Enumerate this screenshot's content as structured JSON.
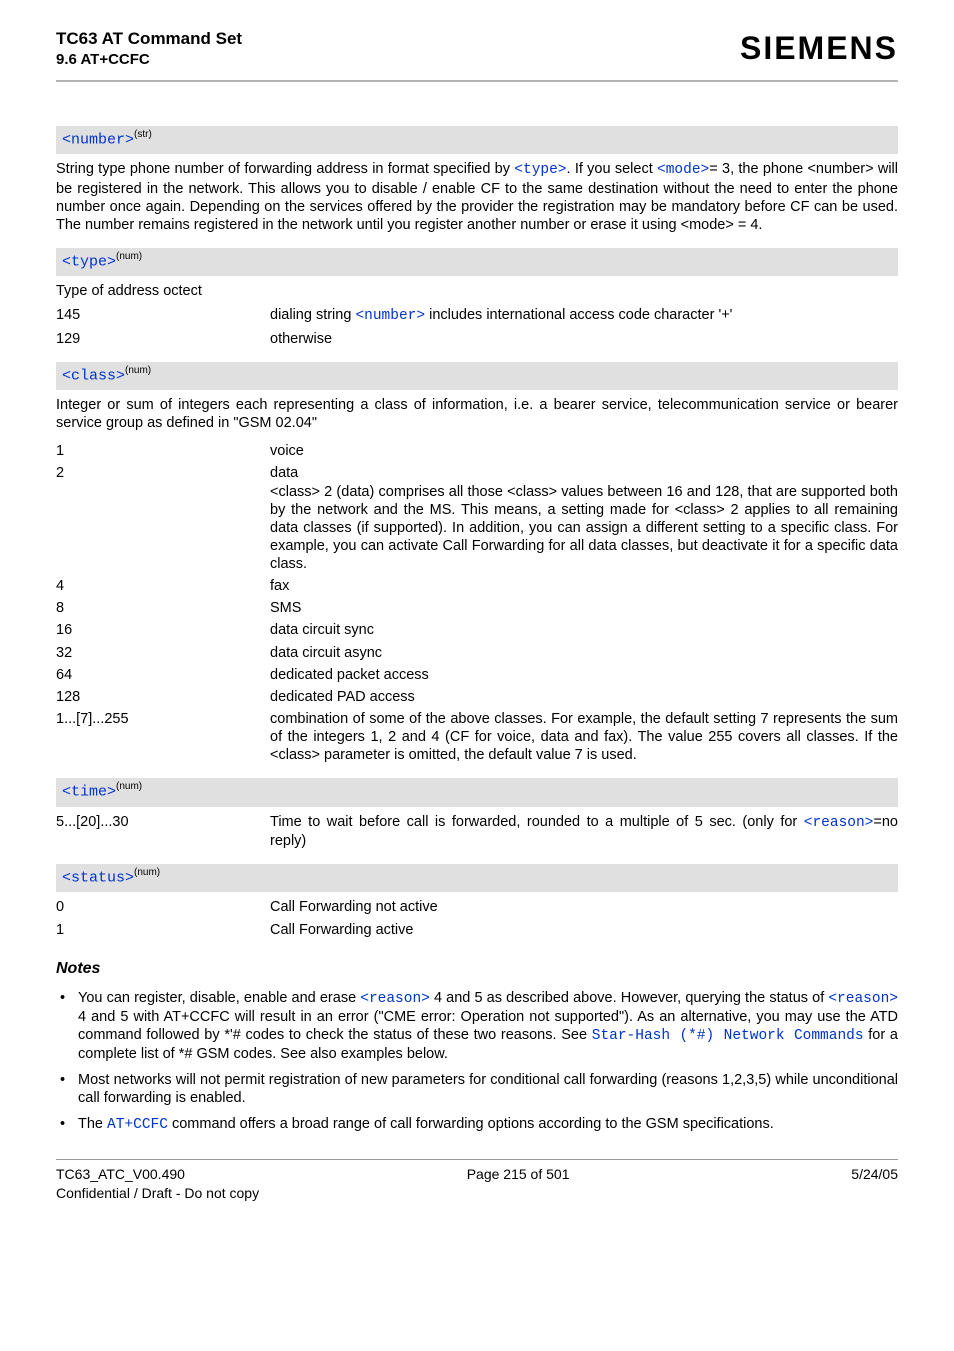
{
  "header": {
    "doc_title": "TC63 AT Command Set",
    "doc_subtitle": "9.6 AT+CCFC",
    "brand": "SIEMENS"
  },
  "params": {
    "number": {
      "name": "<number>",
      "sup": "(str)",
      "desc_pre": "String type phone number of forwarding address in format specified by ",
      "link1": "<type>",
      "desc_mid": ". If you select ",
      "link2": "<mode>",
      "desc_post": "= 3, the phone <number> will be registered in the network. This allows you to disable / enable CF to the same destination without the need to enter the phone number once again. Depending on the services offered by the provider the registration may be mandatory before CF can be used. The number remains registered in the network until you register another number or erase it using <mode> = 4."
    },
    "type": {
      "name": "<type>",
      "sup": "(num)",
      "desc": "Type of address octect",
      "rows": [
        {
          "k": "145",
          "pre": "dialing string ",
          "link": "<number>",
          "post": " includes international access code character '+'"
        },
        {
          "k": "129",
          "pre": "otherwise",
          "link": "",
          "post": ""
        }
      ]
    },
    "class": {
      "name": "<class>",
      "sup": "(num)",
      "desc": "Integer or sum of integers each representing a class of information, i.e. a bearer service, telecommunication service or bearer service group as defined in \"GSM 02.04\"",
      "rows": [
        {
          "k": "1",
          "v": "voice"
        },
        {
          "k": "2",
          "v": "data\n<class> 2 (data) comprises all those <class> values between 16 and 128, that are supported both by the network and the MS. This means, a setting made for <class> 2 applies to all remaining data classes (if supported). In addition, you can assign a different setting to a specific class. For example, you can activate Call Forwarding for all data classes, but deactivate it for a specific data class."
        },
        {
          "k": "4",
          "v": "fax"
        },
        {
          "k": "8",
          "v": "SMS"
        },
        {
          "k": "16",
          "v": "data circuit sync"
        },
        {
          "k": "32",
          "v": "data circuit async"
        },
        {
          "k": "64",
          "v": "dedicated packet access"
        },
        {
          "k": "128",
          "v": "dedicated PAD access"
        },
        {
          "k": "1...[7]...255",
          "v": "combination of some of the above classes. For example, the default setting 7 represents the sum of the integers 1, 2 and 4 (CF for voice, data and fax). The value 255 covers all classes. If the <class> parameter is omitted, the default value 7 is used."
        }
      ]
    },
    "time": {
      "name": "<time>",
      "sup": "(num)",
      "row": {
        "k": "5...[20]...30",
        "pre": "Time to wait before call is forwarded, rounded to a multiple of 5 sec. (only for ",
        "link": "<reason>",
        "post": "=no reply)"
      }
    },
    "status": {
      "name": "<status>",
      "sup": "(num)",
      "rows": [
        {
          "k": "0",
          "v": "Call Forwarding not active"
        },
        {
          "k": "1",
          "v": "Call Forwarding active"
        }
      ]
    }
  },
  "notes": {
    "heading": "Notes",
    "items": [
      {
        "pre": "You can register, disable, enable and erase ",
        "link1": "<reason>",
        "mid1": " 4 and 5 as described above. However, querying the status of ",
        "link2": "<reason>",
        "mid2": " 4 and 5 with AT+CCFC will result in an error (\"CME error: Operation not supported\"). As an alternative, you may use the ATD command followed by *'# codes to check the status of these two reasons. See ",
        "link3": "Star-Hash (*#) Network Commands",
        "post": " for a complete list of *# GSM codes. See also examples below."
      },
      {
        "pre": "Most networks will not permit registration of new parameters for conditional call forwarding (reasons 1,2,3,5) while unconditional call forwarding is enabled.",
        "link1": "",
        "mid1": "",
        "link2": "",
        "mid2": "",
        "link3": "",
        "post": ""
      },
      {
        "pre": "The ",
        "link1": "AT+CCFC",
        "mid1": " command offers a broad range of call forwarding options according to the GSM specifications.",
        "link2": "",
        "mid2": "",
        "link3": "",
        "post": ""
      }
    ]
  },
  "footer": {
    "left": "TC63_ATC_V00.490",
    "center": "Page 215 of 501",
    "right": "5/24/05",
    "second": "Confidential / Draft - Do not copy"
  }
}
